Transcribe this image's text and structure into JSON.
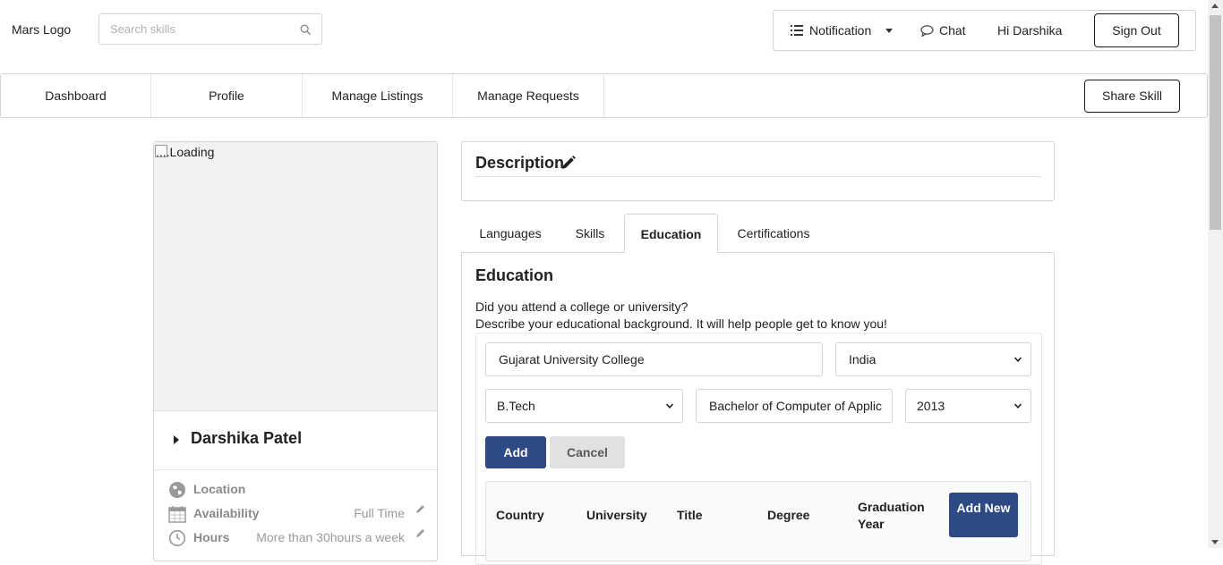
{
  "header": {
    "logo": "Mars Logo",
    "search_placeholder": "Search skills",
    "notification": "Notification",
    "chat": "Chat",
    "greeting": "Hi Darshika",
    "sign_out": "Sign Out"
  },
  "nav": {
    "items": [
      "Dashboard",
      "Profile",
      "Manage Listings",
      "Manage Requests"
    ],
    "share_skill": "Share Skill"
  },
  "profile": {
    "photo_alt": "....Loading",
    "name": "Darshika Patel",
    "details": [
      {
        "label": "Location",
        "value": "",
        "icon": "globe-icon"
      },
      {
        "label": "Availability",
        "value": "Full Time",
        "icon": "calendar-icon"
      },
      {
        "label": "Hours",
        "value": "More than 30hours a week",
        "icon": "clock-icon"
      }
    ]
  },
  "description": {
    "title": "Description"
  },
  "tabs": {
    "items": [
      "Languages",
      "Skills",
      "Education",
      "Certifications"
    ],
    "active": "Education"
  },
  "education": {
    "title": "Education",
    "line1": "Did you attend a college or university?",
    "line2": "Describe your educational background. It will help people get to know you!",
    "university": "Gujarat University College",
    "country": "India",
    "title_select": "B.Tech",
    "degree": "Bachelor of Computer of Applic",
    "year": "2013",
    "add_button": "Add",
    "cancel_button": "Cancel",
    "columns": [
      "Country",
      "University",
      "Title",
      "Degree",
      "Graduation Year"
    ],
    "add_new": "Add New"
  },
  "colors": {
    "primary": "#2e4a86",
    "border": "#d4d4d5",
    "secondary_button": "#e0e1e2"
  }
}
